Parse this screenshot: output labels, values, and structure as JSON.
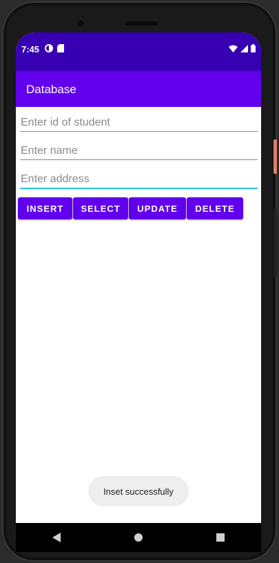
{
  "status_bar": {
    "time": "7:45"
  },
  "app_bar": {
    "title": "Database"
  },
  "form": {
    "id_placeholder": "Enter id of student",
    "name_placeholder": "Enter name",
    "address_placeholder": "Enter address"
  },
  "buttons": {
    "insert": "INSERT",
    "select": "SELECT",
    "update": "UPDATE",
    "delete": "DELETE"
  },
  "toast": {
    "message": "Inset successfully"
  },
  "colors": {
    "status_bar": "#3700b3",
    "app_bar": "#6200ee",
    "button": "#6200ee",
    "focus_underline": "#26c6da"
  },
  "icons": {
    "status_left": [
      "data-saver-icon",
      "sd-card-icon"
    ],
    "status_right": [
      "wifi-icon",
      "signal-icon",
      "battery-icon"
    ],
    "navigation": [
      "back-icon",
      "home-icon",
      "recents-icon"
    ]
  }
}
